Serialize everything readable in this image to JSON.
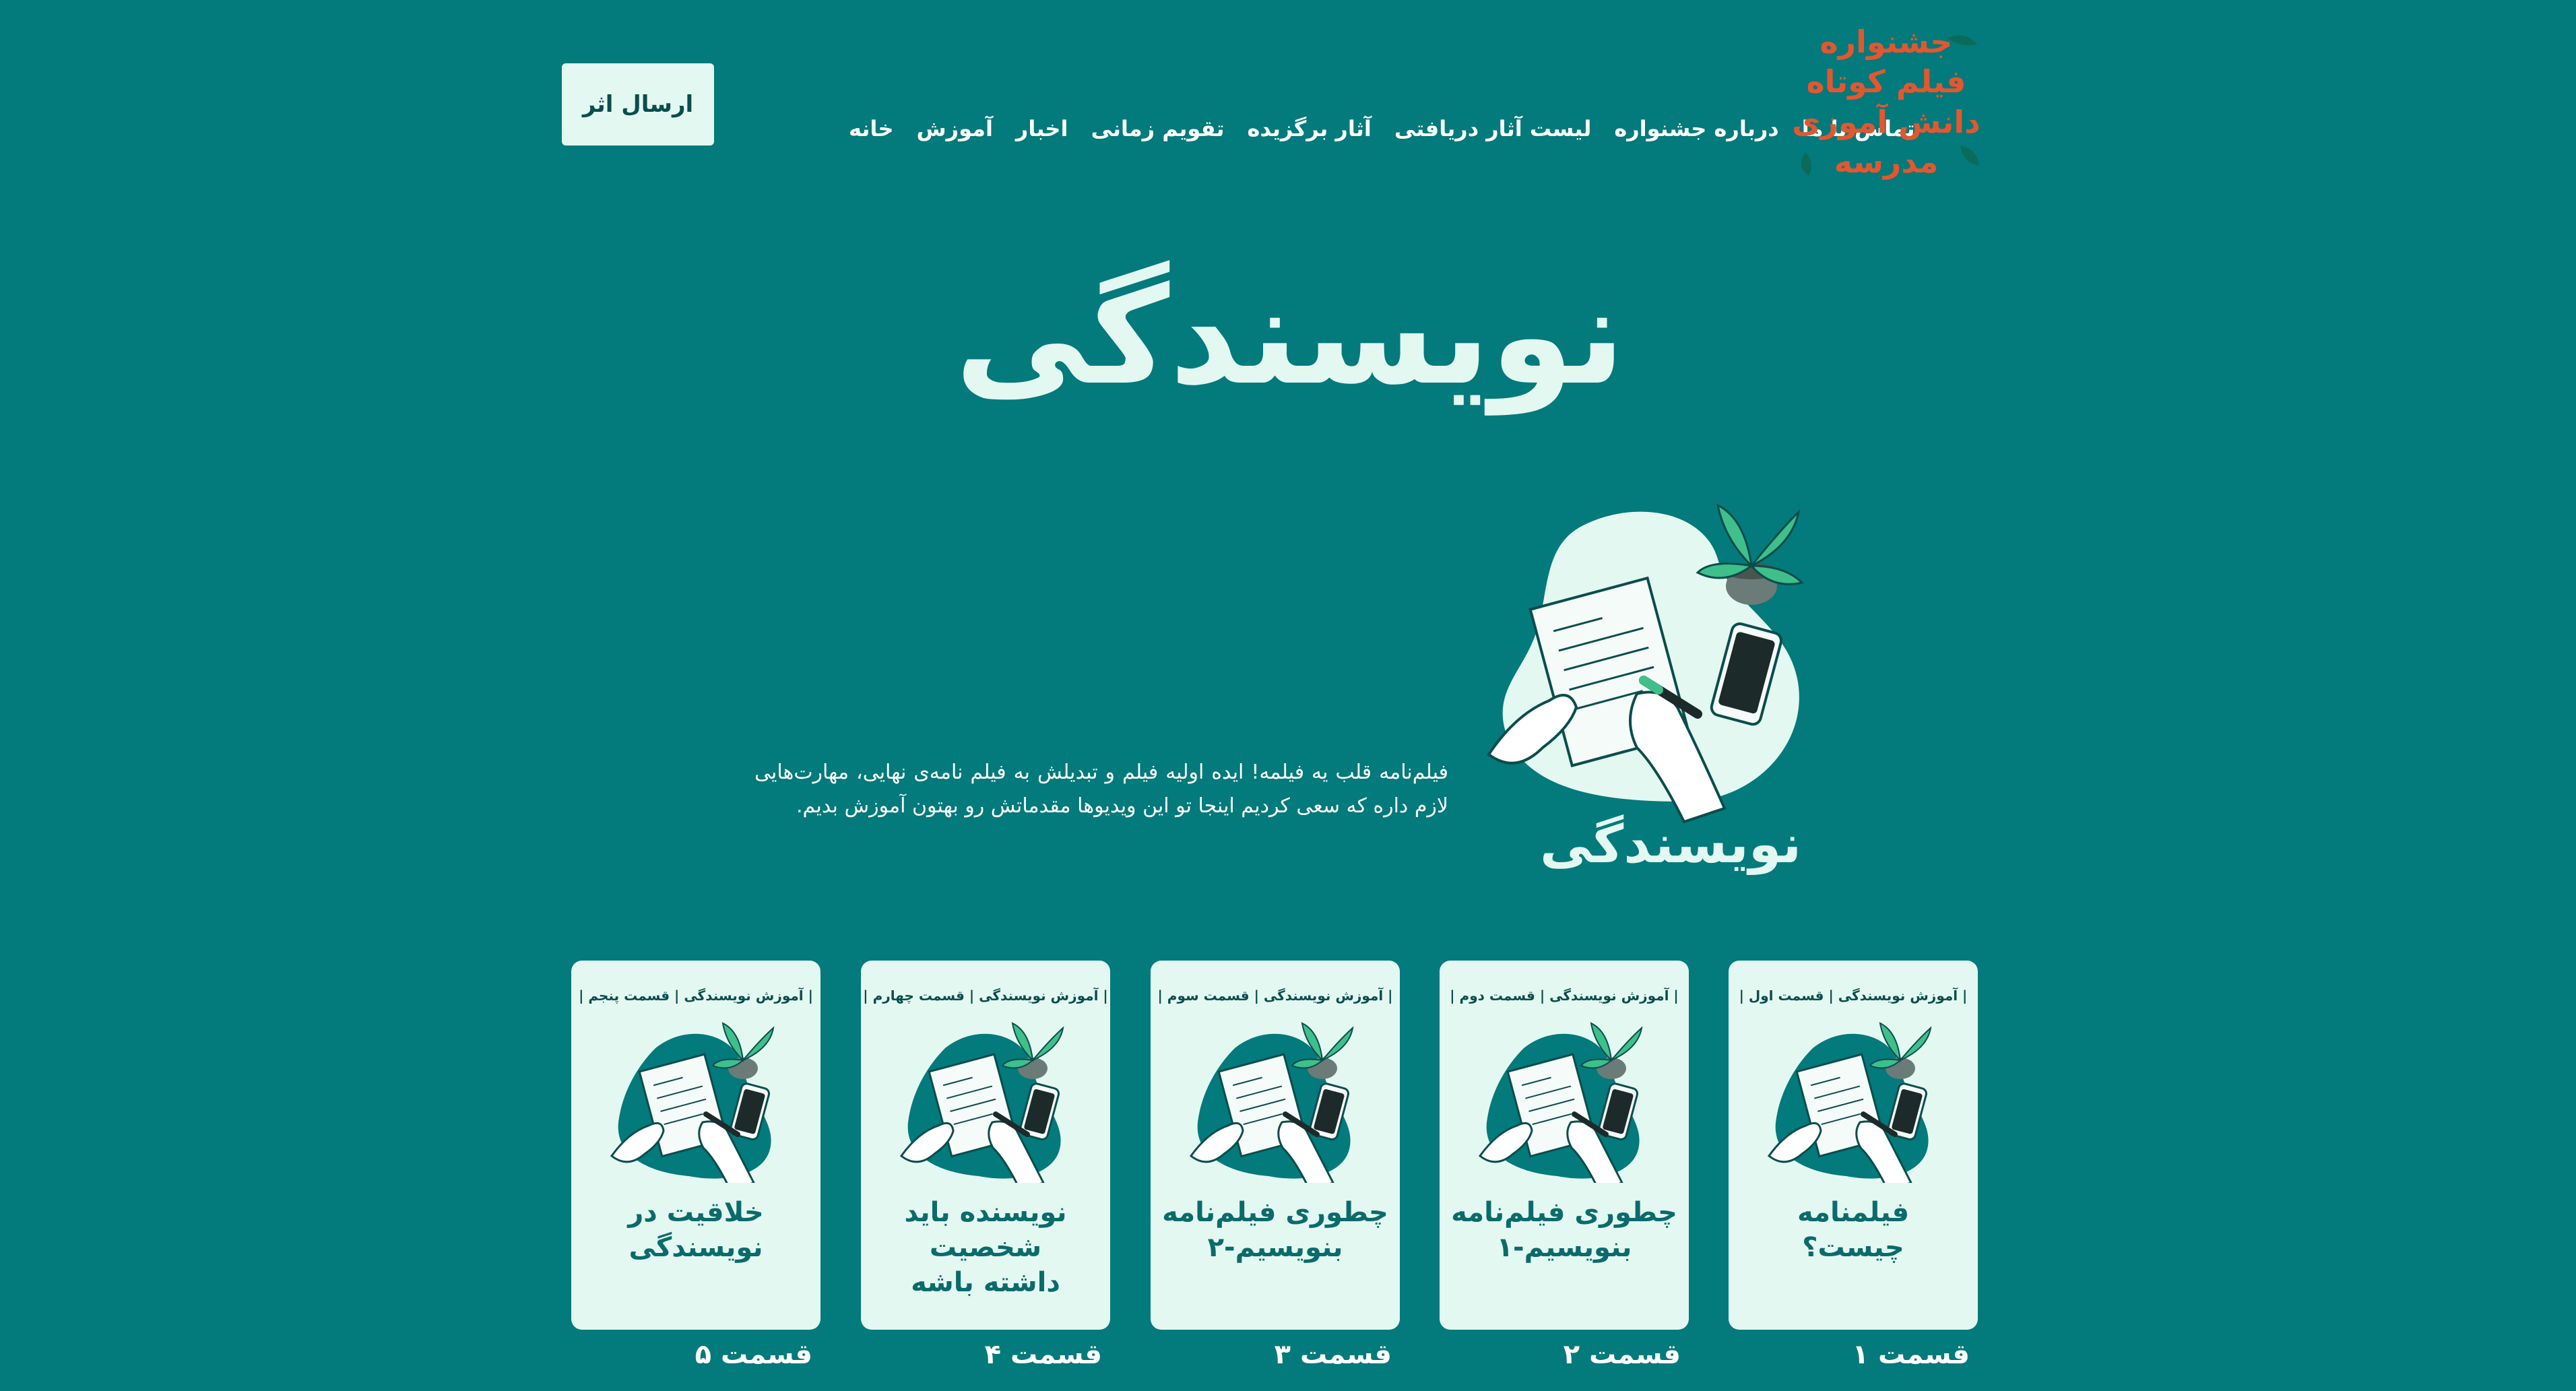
{
  "header": {
    "submit_label": "ارسال اثر",
    "nav": [
      "خانه",
      "آموزش",
      "اخبار",
      "تقویم زمانی",
      "آثار برگزیده",
      "لیست آثار دریافتی",
      "درباره جشنواره",
      "تماس با ما"
    ],
    "logo_lines": [
      "جشنواره",
      "فیلم کوتاه",
      "دانش آموزی",
      "مدرسه"
    ]
  },
  "page": {
    "title": "نویسندگی",
    "intro": "فیلم‌نامه قلب یه فیلمه! ایده اولیه فیلم و تبدیلش به فیلم نامه‌ی نهایی، مهارت‌هایی لازم داره که سعی کردیم اینجا تو این ویدیوها مقدماتش رو بهتون آموزش بدیم.",
    "hero_caption": "نویسندگی"
  },
  "cards": [
    {
      "header": "| آموزش نویسندگی | قسمت اول |",
      "title_line1": "فیلمنامه",
      "title_line2": "چیست؟",
      "caption": "قسمت ۱"
    },
    {
      "header": "| آموزش نویسندگی | قسمت دوم |",
      "title_line1": "چطوری فیلم‌نامه",
      "title_line2": "بنویسیم-۱",
      "caption": "قسمت ۲"
    },
    {
      "header": "| آموزش نویسندگی | قسمت سوم |",
      "title_line1": "چطوری فیلم‌نامه",
      "title_line2": "بنویسیم-۲",
      "caption": "قسمت ۳"
    },
    {
      "header": "| آموزش نویسندگی | قسمت چهارم |",
      "title_line1": "نویسنده باید شخصیت",
      "title_line2": "داشته باشه",
      "caption": "قسمت ۴"
    },
    {
      "header": "| آموزش نویسندگی | قسمت پنجم |",
      "title_line1": "خلاقیت در",
      "title_line2": "نویسندگی",
      "caption": "قسمت ۵"
    }
  ],
  "colors": {
    "background": "#037a7b",
    "card": "#e3f8f1",
    "accent_logo": "#e4572e",
    "dark_teal": "#0b4d4d"
  },
  "icons": [
    "plant-icon",
    "phone-icon",
    "writing-hands-icon",
    "pen-icon"
  ]
}
